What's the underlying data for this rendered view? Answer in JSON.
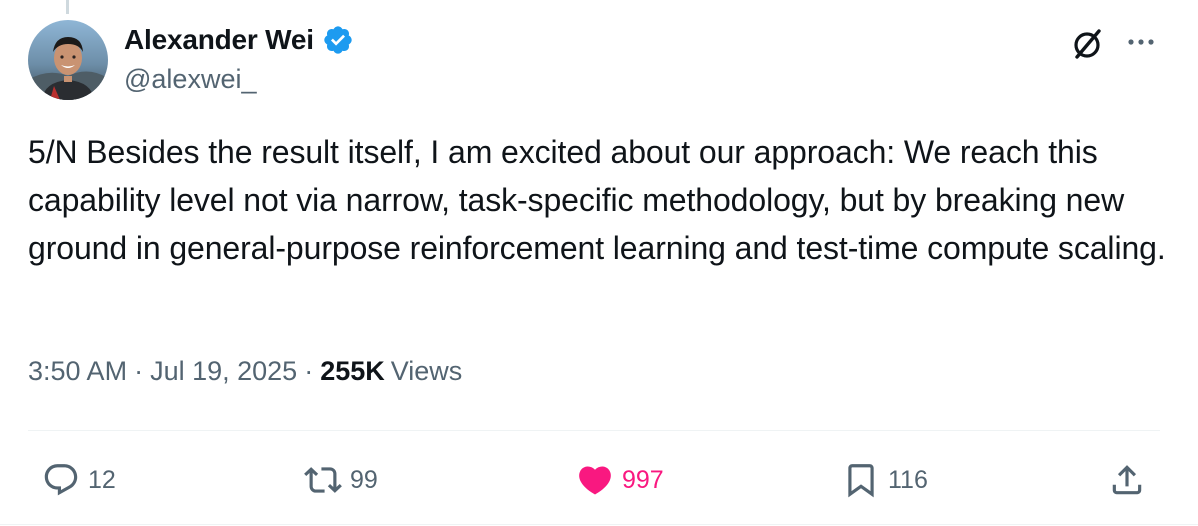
{
  "author": {
    "name": "Alexander Wei",
    "handle": "@alexwei_",
    "verified": true,
    "verified_color": "#1d9bf0"
  },
  "tweet": {
    "text": "5/N Besides the result itself, I am excited about our approach: We reach this capability level not via narrow, task-specific methodology, but by breaking new ground in general-purpose reinforcement learning and test-time compute scaling.",
    "time": "3:50 AM",
    "date": "Jul 19, 2025",
    "separator": "·",
    "views_count": "255K",
    "views_label": "Views"
  },
  "actions": {
    "replies": "12",
    "reposts": "99",
    "likes": "997",
    "bookmarks": "116"
  },
  "colors": {
    "text_primary": "#0f1419",
    "text_secondary": "#536471",
    "like_pink": "#f91880",
    "divider": "#eff3f4"
  },
  "icons": {
    "reply": "speech-bubble-icon",
    "repost": "repost-arrows-icon",
    "like": "heart-filled-icon",
    "bookmark": "bookmark-icon",
    "share": "share-upload-icon",
    "grok": "grok-slash-circle-icon",
    "more": "ellipsis-icon",
    "verified": "verified-badge-icon"
  }
}
